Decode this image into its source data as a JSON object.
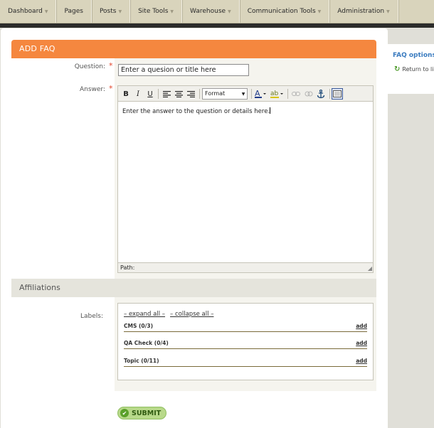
{
  "nav": {
    "items": [
      {
        "label": "Dashboard"
      },
      {
        "label": "Pages"
      },
      {
        "label": "Posts"
      },
      {
        "label": "Site Tools"
      },
      {
        "label": "Warehouse"
      },
      {
        "label": "Communication Tools"
      },
      {
        "label": "Administration"
      }
    ]
  },
  "form": {
    "title": "ADD FAQ",
    "question_label": "Question:",
    "question_value": "Enter a quesion or title here",
    "answer_label": "Answer:",
    "required_mark": "*",
    "editor": {
      "format_label": "Format",
      "body_text": "Enter the answer to the question or details here.",
      "path_label": "Path:",
      "toolbar_icons": [
        "bold-icon",
        "italic-icon",
        "underline-icon",
        "align-left-icon",
        "align-center-icon",
        "align-right-icon",
        "text-color-icon",
        "background-color-icon",
        "link-icon",
        "unlink-icon",
        "anchor-icon",
        "code-icon"
      ]
    }
  },
  "affiliations": {
    "title": "Affiliations",
    "labels_label": "Labels:",
    "expand_all": "– expand all –",
    "collapse_all": "– collapse all –",
    "rows": [
      {
        "label": "CMS (0/3)",
        "add": "add"
      },
      {
        "label": "QA Check (0/4)",
        "add": "add"
      },
      {
        "label": "Topic (0/11)",
        "add": "add"
      }
    ]
  },
  "submit_label": "SUBMIT",
  "sidebar": {
    "title": "FAQ options",
    "return_label": "Return to li"
  },
  "colors": {
    "header_orange": "#f5873f",
    "nav_bg": "#d9d4bc",
    "link_blue": "#3a7bbf",
    "submit_green": "#b8d98a"
  }
}
